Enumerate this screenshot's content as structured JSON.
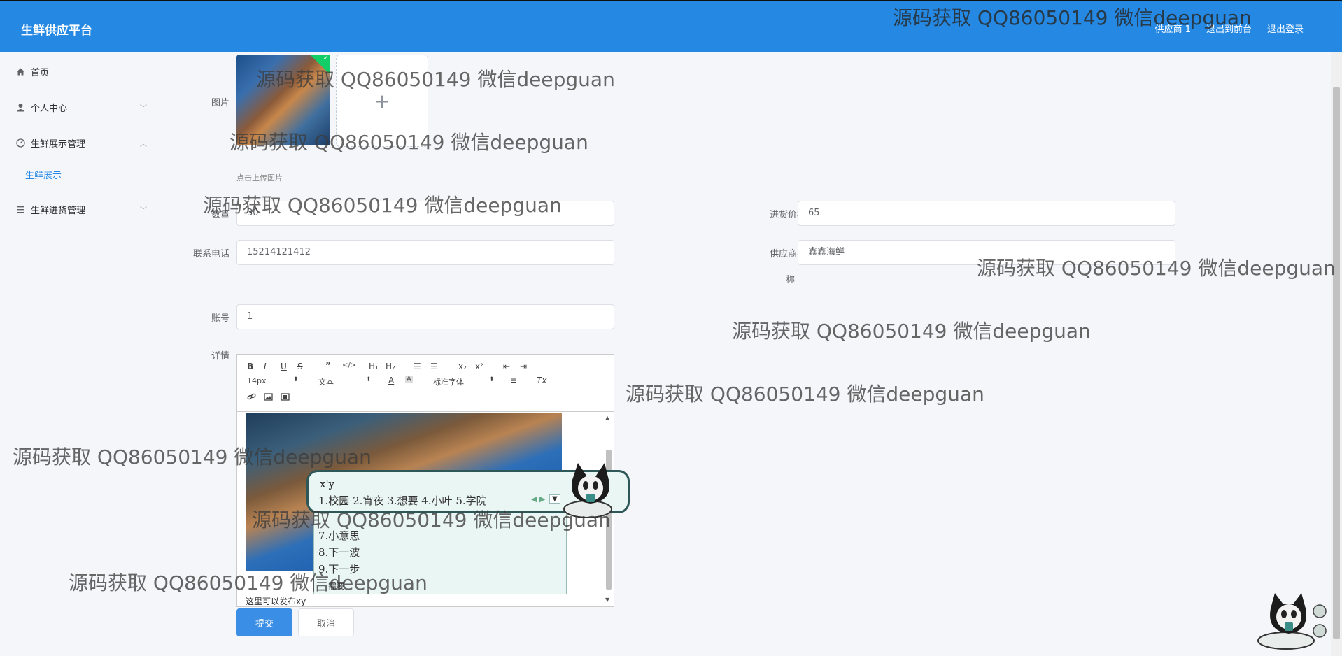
{
  "header": {
    "brand": "生鲜供应平台",
    "nav": [
      "供应商 1",
      "退出到前台",
      "退出登录"
    ]
  },
  "sidebar": {
    "items": [
      {
        "label": "首页",
        "icon": "home-icon"
      },
      {
        "label": "个人中心",
        "icon": "user-icon"
      },
      {
        "label": "生鲜展示管理",
        "icon": "gauge-icon"
      },
      {
        "label": "生鲜进货管理",
        "icon": "list-icon"
      }
    ],
    "submenu_active": "生鲜展示"
  },
  "form": {
    "image_label": "图片",
    "upload_hint": "点击上传图片",
    "quantity_label": "数量",
    "quantity_value": "30",
    "price_label": "进货价格",
    "price_value": "65",
    "phone_label": "联系电话",
    "phone_value": "15214121412",
    "supplier_label": "供应商名",
    "supplier_label_wrap": "称",
    "supplier_value": "鑫鑫海鲜",
    "account_label": "账号",
    "account_value": "1",
    "detail_label": "详情"
  },
  "editor": {
    "font_size": "14px",
    "text_type": "文本",
    "font_family": "标准字体",
    "content_text": "这里可以发布xy"
  },
  "ime": {
    "input": "x'y",
    "row1": "1.校园  2.宵夜  3.想要  4.小叶  5.学院",
    "candidates": [
      "7.小意思",
      "8.下一波",
      "9.下一步"
    ],
    "bottom": "需要"
  },
  "actions": {
    "submit": "提交",
    "cancel": "取消"
  },
  "watermark": "源码获取 QQ86050149 微信deepguan",
  "colors": {
    "header": "#2589e4",
    "accent": "#3a8ee6",
    "upload_ok": "#13ce66"
  }
}
